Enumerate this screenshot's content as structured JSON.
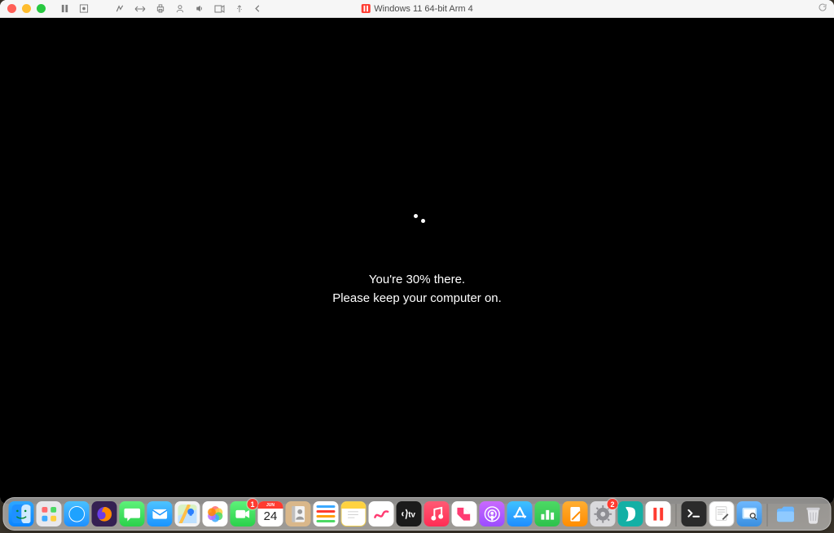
{
  "window": {
    "title": "Windows 11 64-bit Arm 4"
  },
  "update": {
    "line1": "You're 30% there.",
    "line2": "Please keep your computer on."
  },
  "calendar": {
    "month": "JUN",
    "day": "24"
  },
  "badges": {
    "facetime": "1",
    "settings": "2"
  },
  "dock": {
    "items": [
      {
        "name": "finder",
        "label": "Finder"
      },
      {
        "name": "launchpad",
        "label": "Launchpad"
      },
      {
        "name": "safari",
        "label": "Safari"
      },
      {
        "name": "firefox",
        "label": "Firefox"
      },
      {
        "name": "messages",
        "label": "Messages"
      },
      {
        "name": "mail",
        "label": "Mail"
      },
      {
        "name": "maps",
        "label": "Maps"
      },
      {
        "name": "photos",
        "label": "Photos"
      },
      {
        "name": "facetime",
        "label": "FaceTime"
      },
      {
        "name": "calendar",
        "label": "Calendar"
      },
      {
        "name": "contacts",
        "label": "Contacts"
      },
      {
        "name": "reminders",
        "label": "Reminders"
      },
      {
        "name": "notes",
        "label": "Notes"
      },
      {
        "name": "freeform",
        "label": "Freeform"
      },
      {
        "name": "tv",
        "label": "TV"
      },
      {
        "name": "music",
        "label": "Music"
      },
      {
        "name": "news",
        "label": "News"
      },
      {
        "name": "podcasts",
        "label": "Podcasts"
      },
      {
        "name": "appstore",
        "label": "App Store"
      },
      {
        "name": "numbers",
        "label": "Numbers"
      },
      {
        "name": "pages",
        "label": "Pages"
      },
      {
        "name": "settings",
        "label": "System Settings"
      },
      {
        "name": "surfshark",
        "label": "Surfshark"
      },
      {
        "name": "parallels",
        "label": "Parallels Desktop"
      },
      {
        "name": "terminal",
        "label": "Terminal"
      },
      {
        "name": "textedit",
        "label": "TextEdit"
      },
      {
        "name": "preview",
        "label": "Preview"
      },
      {
        "name": "downloads",
        "label": "Downloads"
      },
      {
        "name": "trash",
        "label": "Trash"
      }
    ]
  }
}
